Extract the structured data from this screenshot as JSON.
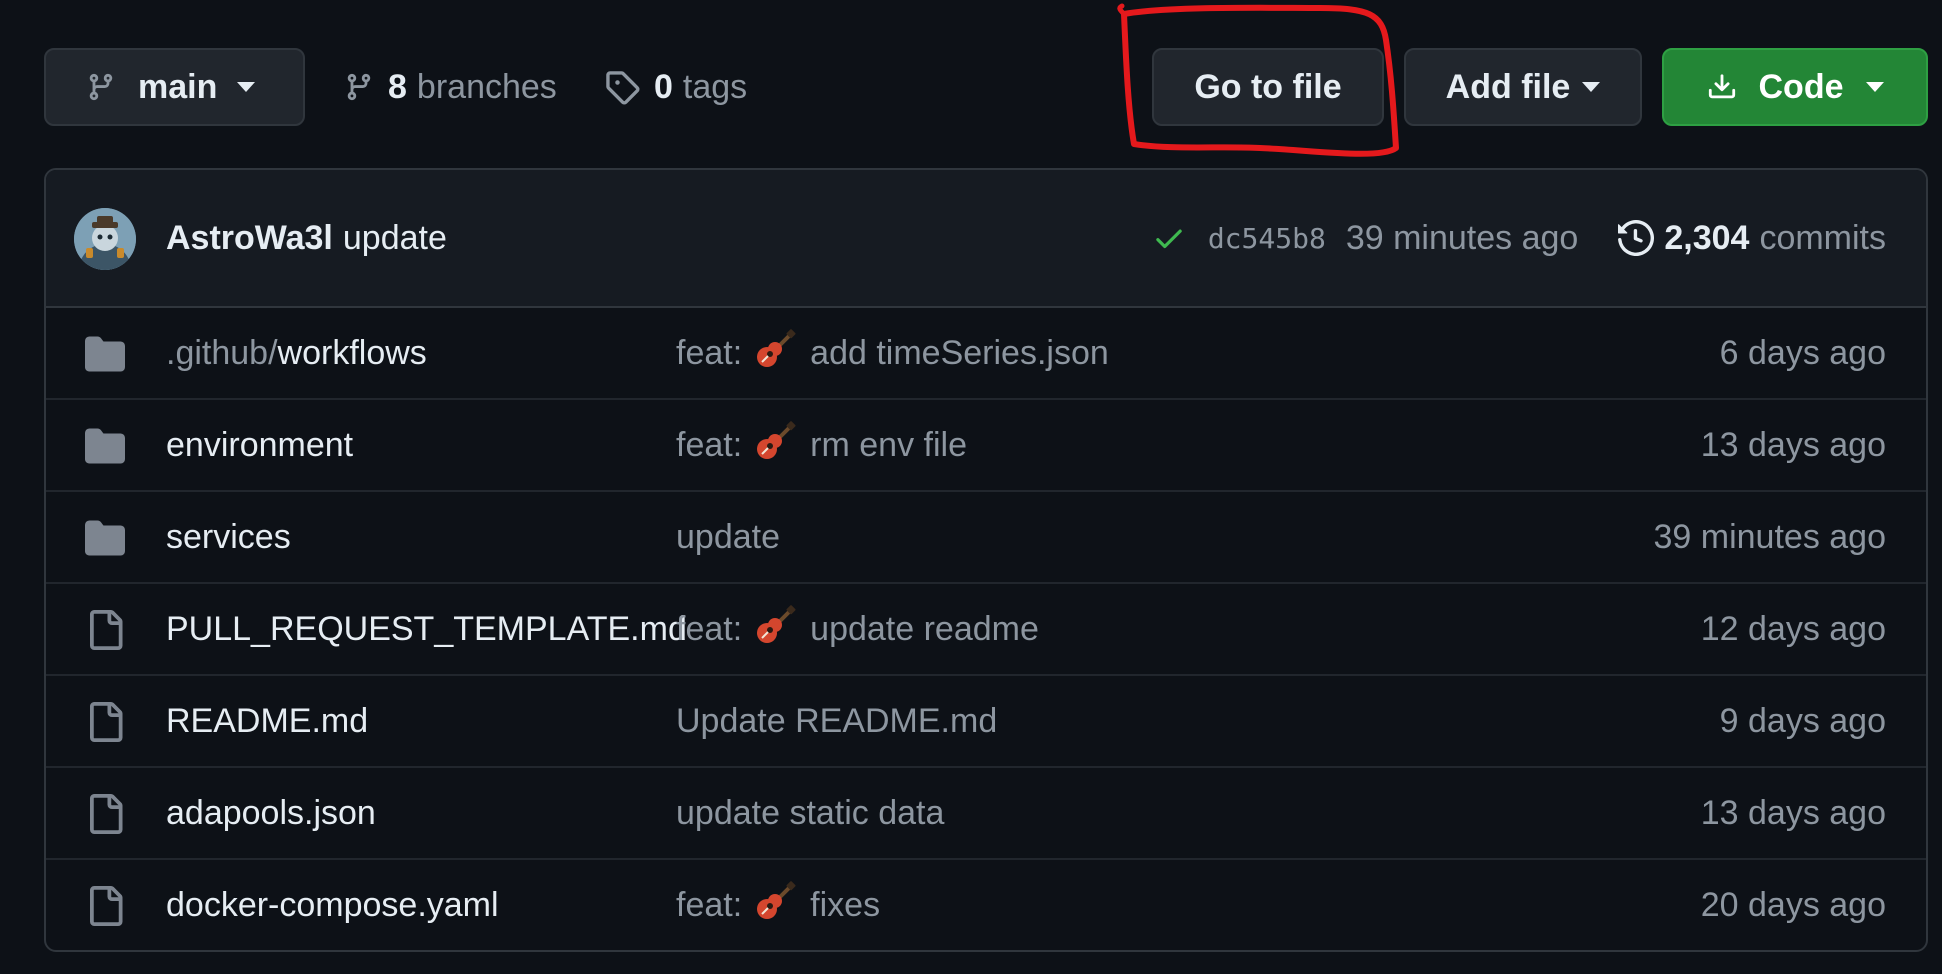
{
  "toolbar": {
    "branch_label": "main",
    "branches_count": "8",
    "branches_label": "branches",
    "tags_count": "0",
    "tags_label": "tags",
    "go_to_file_label": "Go to file",
    "add_file_label": "Add file",
    "code_label": "Code"
  },
  "colors": {
    "background": "#0d1117",
    "code_button": "#238636",
    "annotation": "#e5191c",
    "check": "#3fb950"
  },
  "latest_commit": {
    "author": "AstroWa3l",
    "message": "update",
    "sha": "dc545b8",
    "age": "39 minutes ago",
    "commits_count": "2,304",
    "commits_label": "commits"
  },
  "files": [
    {
      "type": "folder",
      "name_prefix": ".github/",
      "name": "workflows",
      "message_prefix": "feat:",
      "emoji": "guitar",
      "message": "add timeSeries.json",
      "age": "6 days ago"
    },
    {
      "type": "folder",
      "name_prefix": "",
      "name": "environment",
      "message_prefix": "feat:",
      "emoji": "guitar",
      "message": "rm env file",
      "age": "13 days ago"
    },
    {
      "type": "folder",
      "name_prefix": "",
      "name": "services",
      "message_prefix": "",
      "emoji": "",
      "message": "update",
      "age": "39 minutes ago"
    },
    {
      "type": "file",
      "name_prefix": "",
      "name": "PULL_REQUEST_TEMPLATE.md",
      "message_prefix": "feat:",
      "emoji": "guitar",
      "message": "update readme",
      "age": "12 days ago"
    },
    {
      "type": "file",
      "name_prefix": "",
      "name": "README.md",
      "message_prefix": "",
      "emoji": "",
      "message": "Update README.md",
      "age": "9 days ago"
    },
    {
      "type": "file",
      "name_prefix": "",
      "name": "adapools.json",
      "message_prefix": "",
      "emoji": "",
      "message": "update static data",
      "age": "13 days ago"
    },
    {
      "type": "file",
      "name_prefix": "",
      "name": "docker-compose.yaml",
      "message_prefix": "feat:",
      "emoji": "guitar",
      "message": "fixes",
      "age": "20 days ago"
    }
  ]
}
